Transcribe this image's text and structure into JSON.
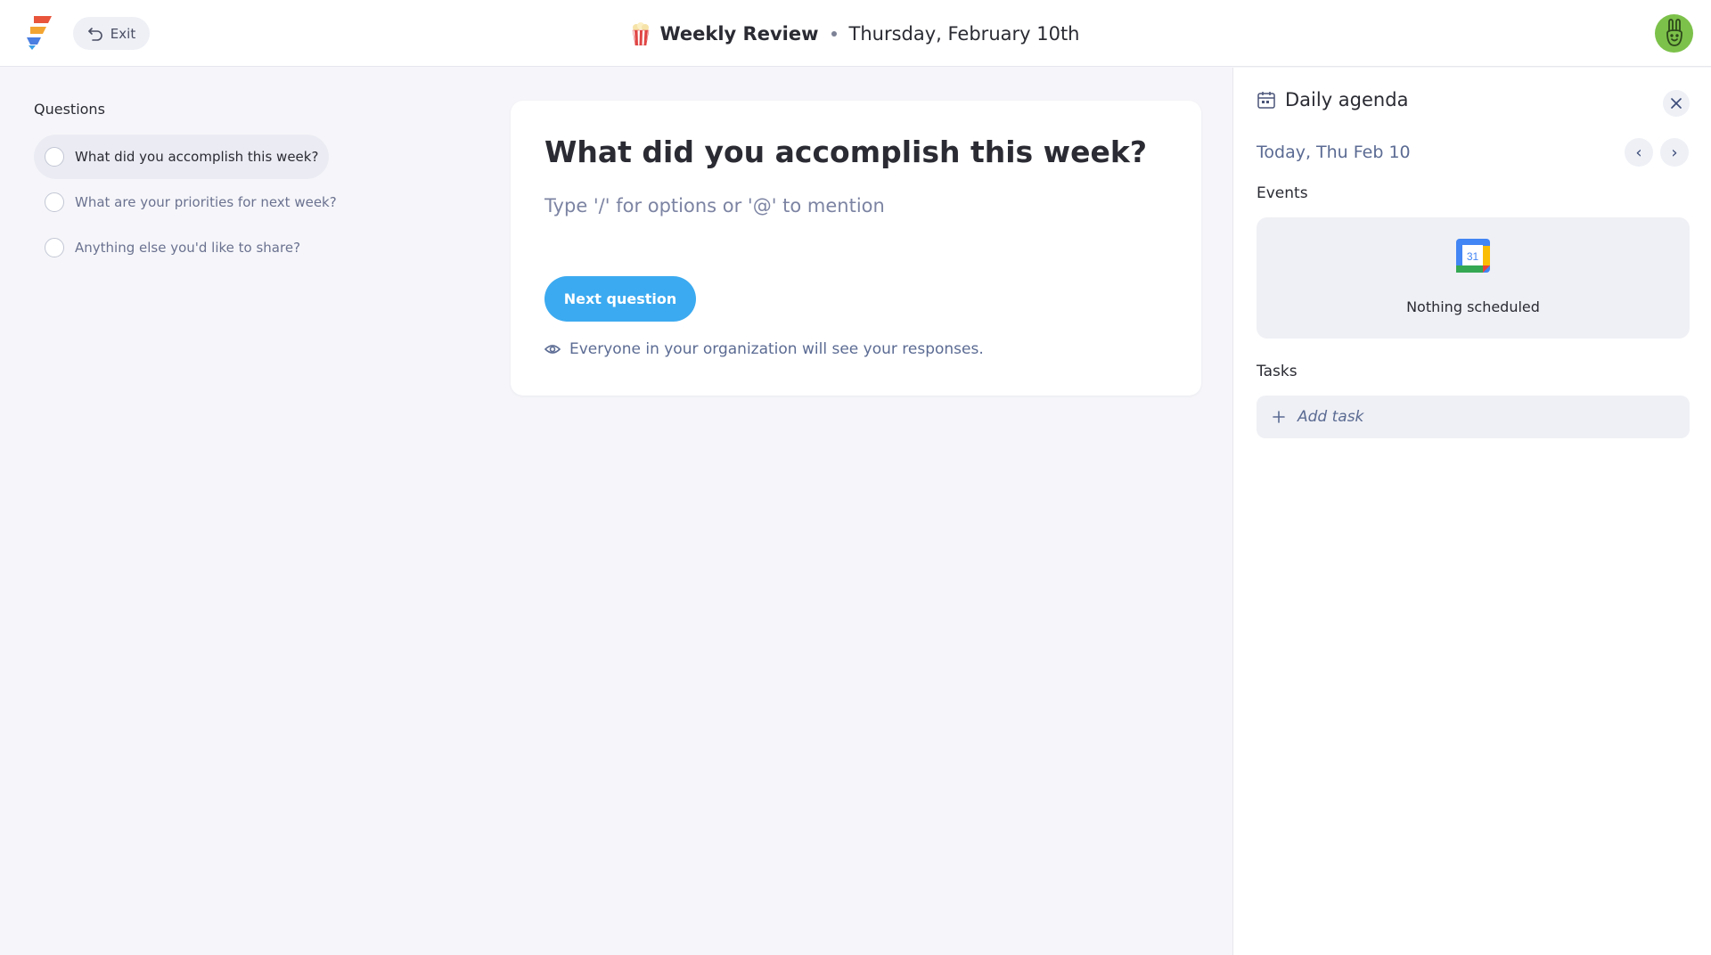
{
  "header": {
    "exit_label": "Exit",
    "title": "Weekly Review",
    "date": "Thursday, February 10th"
  },
  "questions": {
    "heading": "Questions",
    "items": [
      {
        "label": "What did you accomplish this week?",
        "active": true
      },
      {
        "label": "What are your priorities for next week?",
        "active": false
      },
      {
        "label": "Anything else you'd like to share?",
        "active": false
      }
    ]
  },
  "card": {
    "question": "What did you accomplish this week?",
    "input_placeholder": "Type '/' for options or '@' to mention",
    "input_value": "",
    "next_button": "Next question",
    "visibility_note": "Everyone in your organization will see your responses."
  },
  "agenda": {
    "title": "Daily agenda",
    "today": "Today, Thu Feb 10",
    "events_label": "Events",
    "calendar_day": "31",
    "empty_events": "Nothing scheduled",
    "tasks_label": "Tasks",
    "add_task": "Add task"
  },
  "colors": {
    "accent": "#3caaf0",
    "avatar_bg": "#7cc14a",
    "muted_text": "#5b6b93"
  },
  "icons": {
    "logo": "app-logo",
    "exit": "undo-arrow-icon",
    "title": "popcorn-icon",
    "avatar": "bunny-avatar",
    "visibility": "eye-icon",
    "agenda": "calendar-icon",
    "close": "close-icon",
    "prev": "chevron-left-icon",
    "next": "chevron-right-icon",
    "events": "google-calendar-icon",
    "add": "plus-icon"
  }
}
